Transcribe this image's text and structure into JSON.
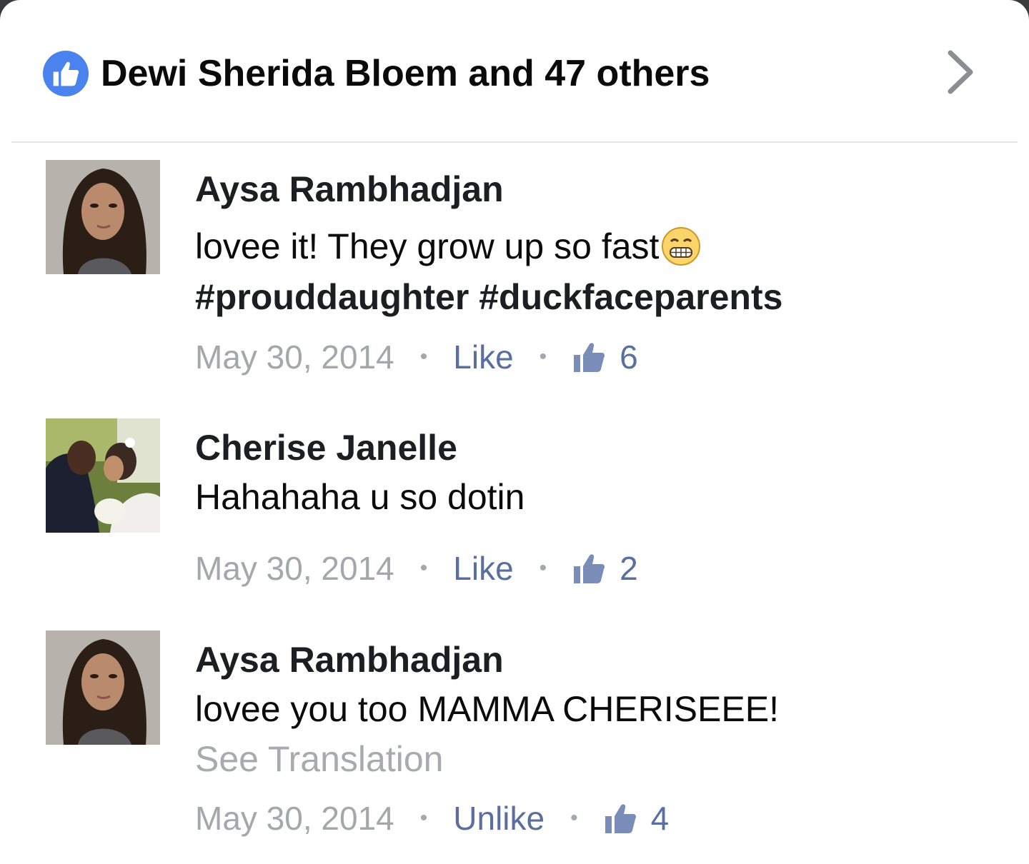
{
  "header": {
    "likes_text": "Dewi Sherida Bloem and 47 others",
    "like_badge_icon": "thumbs-up-icon",
    "chevron_icon": "chevron-right-icon",
    "accent_color": "#4a83ed"
  },
  "comments": [
    {
      "author": "Aysa Rambhadjan",
      "text_line1": "lovee it! They grow up so fast",
      "emoji": "grinning-face-icon",
      "text_line2": "#prouddaughter #duckfaceparents",
      "date": "May 30, 2014",
      "separator": "•",
      "action": "Like",
      "like_count": "6"
    },
    {
      "author": "Cherise Janelle",
      "text_line1": "Hahahaha u so dotin",
      "date": "May 30, 2014",
      "separator": "•",
      "action": "Like",
      "like_count": "2"
    },
    {
      "author": "Aysa Rambhadjan",
      "text_line1": "lovee you too MAMMA CHERISEEE!",
      "see_translation": "See Translation",
      "date": "May 30, 2014",
      "separator": "•",
      "action": "Unlike",
      "like_count": "4"
    }
  ],
  "colors": {
    "link_blue": "#5a6f9f",
    "meta_gray": "#a4a7ab"
  }
}
